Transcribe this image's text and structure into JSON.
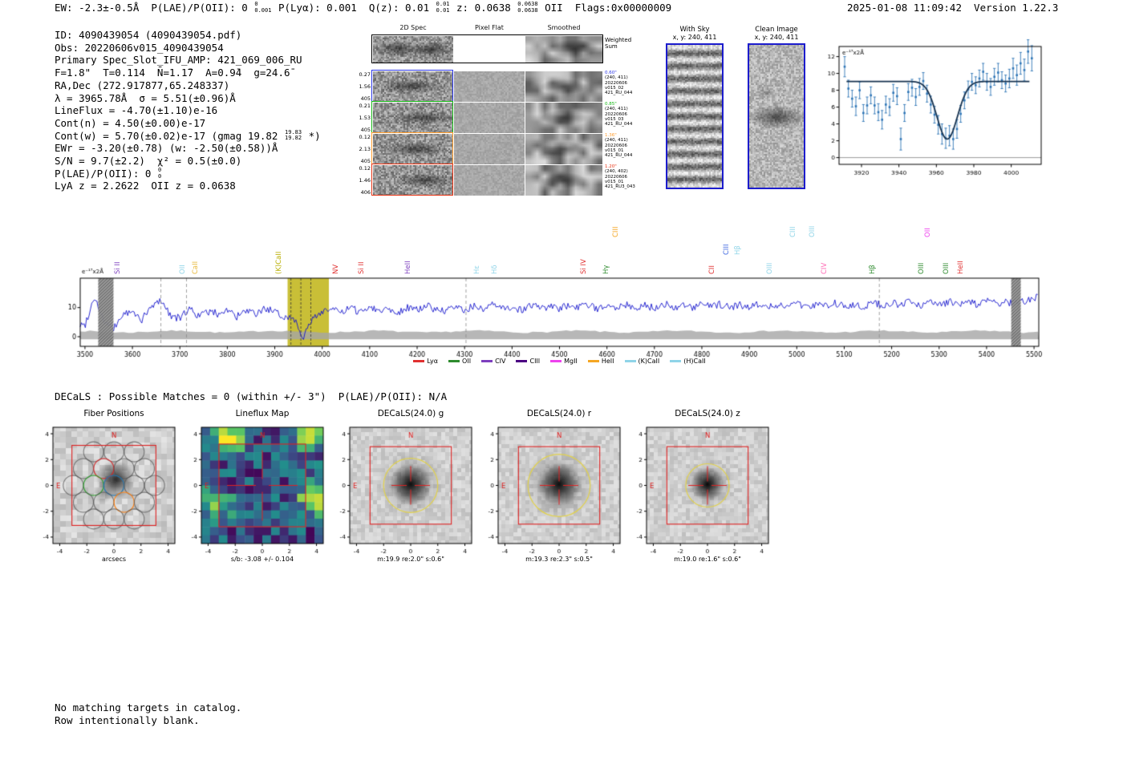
{
  "header": {
    "segments": [
      {
        "t": "EW: -2.3±-0.5Å  P(LAE)/P(OII): 0 "
      },
      {
        "sup": "0",
        "sub": "0.001"
      },
      {
        "t": " P(Lyα): 0.001  Q(z): 0.01 "
      },
      {
        "sup": "0.01",
        "sub": "0.01"
      },
      {
        "t": " z: 0.0638 "
      },
      {
        "sup": "0.0638",
        "sub": "0.0638"
      },
      {
        "t": " OII  Flags:0x00000009"
      }
    ],
    "right": "2025-01-08 11:09:42  Version 1.22.3"
  },
  "info_lines": [
    [
      {
        "t": "ID: 4090439054 (4090439054.pdf)"
      }
    ],
    [
      {
        "t": "Obs: 20220606v015_4090439054"
      }
    ],
    [
      {
        "t": "Primary Spec_Slot_IFU_AMP: 421_069_006_RU"
      }
    ],
    [
      {
        "t": "F=1.8\"  T=0.114  N̄=1.1̄7  A=0.9̄4  g=24.6̄"
      }
    ],
    [
      {
        "t": "RA,Dec (272.917877,65.248337)"
      }
    ],
    [
      {
        "t": "λ = 3965.78Å  σ = 5.51(±0.96)Å"
      }
    ],
    [
      {
        "t": "LineFlux = -4.70(±1.10)e-16"
      }
    ],
    [
      {
        "t": "Cont(n) = 4.50(±0.00)e-17"
      }
    ],
    [
      {
        "t": "Cont(w) = 5.70(±0.02)e-17 (gmag 19.82 "
      },
      {
        "sup": "19.83",
        "sub": "19.82"
      },
      {
        "t": " *)"
      }
    ],
    [
      {
        "t": "EWr = -3.20(±0.78) (w: -2.50(±0.58))Å"
      }
    ],
    [
      {
        "t": "S/N = 9.7(±2.2)  χ² = 0.5(±0.0)"
      }
    ],
    [
      {
        "t": "P(LAE)/P(OII): 0 "
      },
      {
        "sup": "0",
        "sub": "0"
      }
    ],
    [
      {
        "t": "LyA z = 2.2622  OII z = 0.0638"
      }
    ]
  ],
  "spec2d": {
    "col_headers": [
      "2D Spec",
      "Pixel Flat",
      "Smoothed"
    ],
    "weighted_label": "Weighted Sum",
    "rows": [
      {
        "left": [
          "0.27",
          "1.56",
          "405"
        ],
        "border": "#2a35e8",
        "ann": [
          "0.60\"",
          "(240, 411)",
          "20220606",
          "v015_02",
          "421_RU_044"
        ]
      },
      {
        "left": [
          "0.21",
          "1.53",
          "405"
        ],
        "border": "#16b816",
        "ann": [
          "0.85\"",
          "(240, 411)",
          "20220606",
          "v015_03",
          "421_RU_044"
        ]
      },
      {
        "left": [
          "0.12",
          "2.13",
          "405"
        ],
        "border": "#ff9d2e",
        "ann": [
          "1.36\"",
          "(240, 411)",
          "20220606",
          "v015_01",
          "421_RU_044"
        ]
      },
      {
        "left": [
          "0.12",
          "1.46",
          "406"
        ],
        "border": "#e83212",
        "ann": [
          "1.20\"",
          "(240, 402)",
          "20220606",
          "v015_01",
          "421_RU3_043"
        ]
      }
    ]
  },
  "aper": {
    "with_sky": {
      "title": "With Sky",
      "subtitle": "x, y: 240, 411"
    },
    "clean": {
      "title": "Clean Image",
      "subtitle": "x, y: 240, 411"
    }
  },
  "chart_data": [
    {
      "id": "line_fit",
      "type": "scatter",
      "ylabel": "e⁻¹⁷x2Å",
      "xlim": [
        3908,
        4016
      ],
      "ylim": [
        -0.8,
        13.2
      ],
      "xticks": [
        3920,
        3940,
        3960,
        3980,
        4000
      ],
      "yticks": [
        0,
        2,
        4,
        6,
        8,
        10,
        12
      ],
      "fit": {
        "continuum": 9.05,
        "center": 3965.78,
        "sigma": 5.51,
        "depth": 6.85,
        "x0": 3912,
        "x1": 4010
      },
      "points": [
        [
          3911,
          10.8,
          1.2
        ],
        [
          3913,
          8.2,
          1.0
        ],
        [
          3915,
          7.0,
          1.0
        ],
        [
          3917,
          6.1,
          1.1
        ],
        [
          3919,
          8.0,
          1.0
        ],
        [
          3921,
          5.3,
          1.0
        ],
        [
          3923,
          6.2,
          1.0
        ],
        [
          3925,
          7.4,
          1.0
        ],
        [
          3927,
          6.2,
          1.0
        ],
        [
          3929,
          5.4,
          1.0
        ],
        [
          3931,
          4.5,
          1.1
        ],
        [
          3933,
          6.3,
          1.0
        ],
        [
          3935,
          6.0,
          1.0
        ],
        [
          3937,
          7.7,
          1.0
        ],
        [
          3939,
          7.3,
          1.0
        ],
        [
          3941,
          2.2,
          1.3
        ],
        [
          3943,
          5.3,
          1.0
        ],
        [
          3945,
          7.8,
          1.0
        ],
        [
          3947,
          8.3,
          1.0
        ],
        [
          3949,
          7.2,
          1.0
        ],
        [
          3951,
          8.4,
          1.0
        ],
        [
          3953,
          9.1,
          1.0
        ],
        [
          3955,
          7.6,
          1.0
        ],
        [
          3957,
          6.3,
          1.0
        ],
        [
          3959,
          5.1,
          1.0
        ],
        [
          3961,
          3.9,
          1.1
        ],
        [
          3963,
          2.8,
          1.2
        ],
        [
          3965,
          2.3,
          1.2
        ],
        [
          3967,
          2.6,
          1.2
        ],
        [
          3969,
          2.2,
          1.2
        ],
        [
          3971,
          3.4,
          1.1
        ],
        [
          3973,
          5.2,
          1.0
        ],
        [
          3975,
          6.8,
          1.0
        ],
        [
          3977,
          8.1,
          1.0
        ],
        [
          3979,
          9.0,
          1.0
        ],
        [
          3981,
          8.6,
          1.0
        ],
        [
          3983,
          9.4,
          1.0
        ],
        [
          3985,
          10.2,
          1.0
        ],
        [
          3987,
          9.0,
          1.0
        ],
        [
          3989,
          8.4,
          1.0
        ],
        [
          3991,
          9.6,
          1.0
        ],
        [
          3993,
          10.1,
          1.1
        ],
        [
          3995,
          9.2,
          1.0
        ],
        [
          3997,
          8.8,
          1.0
        ],
        [
          3999,
          9.4,
          1.1
        ],
        [
          4001,
          10.6,
          1.2
        ],
        [
          4003,
          9.8,
          1.2
        ],
        [
          4005,
          11.2,
          1.3
        ],
        [
          4007,
          10.4,
          1.3
        ],
        [
          4009,
          12.6,
          1.4
        ],
        [
          4011,
          11.8,
          1.5
        ]
      ]
    },
    {
      "id": "main_spectrum",
      "type": "line",
      "ylabel": "e⁻¹⁷x2Å",
      "xlim": [
        3490,
        5510
      ],
      "ylim": [
        -3.3,
        20.1
      ],
      "xticks": [
        3500,
        3600,
        3700,
        3800,
        3900,
        4000,
        4100,
        4200,
        4300,
        4400,
        4500,
        4600,
        4700,
        4800,
        4900,
        5000,
        5100,
        5200,
        5300,
        5400,
        5500
      ],
      "yticks": [
        0,
        10
      ],
      "x_start": 3500,
      "x_step": 20,
      "values": [
        4.0,
        13.9,
        5.2,
        2.5,
        7.8,
        8.3,
        5.9,
        10.1,
        12.8,
        7.4,
        6.2,
        9.8,
        7.0,
        8.6,
        7.9,
        9.4,
        6.8,
        8.8,
        7.5,
        9.9,
        8.2,
        6.9,
        6.5,
        0.0,
        6.0,
        8.9,
        9.6,
        8.1,
        9.9,
        8.4,
        10.6,
        8.9,
        9.8,
        8.3,
        10.2,
        9.0,
        10.8,
        9.3,
        8.7,
        10.1,
        9.2,
        10.6,
        9.1,
        10.9,
        9.6,
        10.3,
        9.0,
        11.1,
        9.7,
        10.4,
        9.3,
        11.2,
        10.0,
        10.9,
        9.5,
        11.4,
        10.2,
        11.0,
        9.8,
        10.7,
        9.9,
        11.3,
        10.1,
        10.8,
        9.7,
        11.0,
        10.3,
        11.2,
        10.0,
        10.9,
        10.2,
        11.4,
        10.4,
        11.1,
        10.1,
        11.5,
        10.5,
        11.2,
        10.3,
        11.6,
        10.6,
        11.3,
        10.4,
        11.7,
        10.7,
        11.5,
        10.8,
        11.9,
        10.9,
        11.6,
        11.0,
        12.0,
        11.1,
        11.8,
        11.2,
        12.1,
        11.3,
        11.9,
        11.4,
        12.3,
        13.5
      ],
      "highlight": {
        "x0": 3927,
        "x1": 4014,
        "color": "#c9bf37"
      },
      "masked": [
        [
          3528,
          3560
        ],
        [
          5452,
          5472
        ]
      ],
      "dashed_lines": [
        3660,
        3714,
        4303,
        5174
      ],
      "dashed_dark": [
        3934,
        3955,
        3976
      ],
      "line_labels": [
        {
          "label": "Si II",
          "wave": 3597,
          "color": "#7d3fbe",
          "tier": 0
        },
        {
          "label": "OII",
          "wave": 3733,
          "color": "#8fd4e8",
          "tier": 0
        },
        {
          "label": "CaII",
          "wave": 3760,
          "color": "#e8b93c",
          "tier": 0
        },
        {
          "label": "(K)CaII",
          "wave": 3934,
          "color": "#b8ae00",
          "tier": 0
        },
        {
          "label": "NV",
          "wave": 4053,
          "color": "#e03030",
          "tier": 0
        },
        {
          "label": "Si II",
          "wave": 4106,
          "color": "#e03030",
          "tier": 0
        },
        {
          "label": "HeII",
          "wave": 4203,
          "color": "#7d3fbe",
          "tier": 0
        },
        {
          "label": "Hε",
          "wave": 4347,
          "color": "#8fd4e8",
          "tier": 0
        },
        {
          "label": "Hδ",
          "wave": 4384,
          "color": "#8fd4e8",
          "tier": 0
        },
        {
          "label": "Si IV",
          "wave": 4570,
          "color": "#e03030",
          "tier": 0
        },
        {
          "label": "Hγ",
          "wave": 4617,
          "color": "#2e8b2e",
          "tier": 0
        },
        {
          "label": "CIII",
          "wave": 4636,
          "color": "#f5a623",
          "tier": 2
        },
        {
          "label": "CII",
          "wave": 4838,
          "color": "#e03030",
          "tier": 0
        },
        {
          "label": "CIII",
          "wave": 4868,
          "color": "#4169e1",
          "tier": 1
        },
        {
          "label": "Hβ",
          "wave": 4890,
          "color": "#8fd4e8",
          "tier": 1
        },
        {
          "label": "OIII",
          "wave": 4958,
          "color": "#8fd4e8",
          "tier": 0
        },
        {
          "label": "CIII",
          "wave": 5007,
          "color": "#8fd4e8",
          "tier": 2
        },
        {
          "label": "OIII",
          "wave": 5047,
          "color": "#8fd4e8",
          "tier": 2
        },
        {
          "label": "CIV",
          "wave": 5072,
          "color": "#ff69b4",
          "tier": 0
        },
        {
          "label": "Hβ",
          "wave": 5172,
          "color": "#2e8b2e",
          "tier": 0
        },
        {
          "label": "OIII",
          "wave": 5274,
          "color": "#2e8b2e",
          "tier": 0
        },
        {
          "label": "OII",
          "wave": 5287,
          "color": "#ee42ee",
          "tier": 2
        },
        {
          "label": "OIII",
          "wave": 5326,
          "color": "#2e8b2e",
          "tier": 0
        },
        {
          "label": "HeII",
          "wave": 5356,
          "color": "#e03030",
          "tier": 0
        }
      ],
      "legend": [
        {
          "label": "Lyα",
          "color": "#e03030"
        },
        {
          "label": "OII",
          "color": "#2e8b2e"
        },
        {
          "label": "CIV",
          "color": "#7d3fbe"
        },
        {
          "label": "CIII",
          "color": "#4b0082"
        },
        {
          "label": "MgII",
          "color": "#ee42ee"
        },
        {
          "label": "HeII",
          "color": "#f5a623"
        },
        {
          "label": "(K)CaII",
          "color": "#8fd4e8"
        },
        {
          "label": "(H)CaII",
          "color": "#8fd4e8"
        }
      ]
    }
  ],
  "cutouts": {
    "header": "DECaLS : Possible Matches = 0 (within +/- 3\")  P(LAE)/P(OII): N/A",
    "ticks": [
      -4,
      -2,
      0,
      2,
      4
    ],
    "compass": {
      "n": "N",
      "e": "E"
    },
    "panels": [
      {
        "title": "Fiber Positions",
        "xlabel": "arcsecs",
        "type": "fiber"
      },
      {
        "title": "Lineflux Map",
        "xlabel": "s/b: -3.08 +/- 0.104",
        "type": "lineflux"
      },
      {
        "title": "DECaLS(24.0) g",
        "xlabel": "m:19.9 re:2.0\" s:0.6\"",
        "type": "image",
        "aperture_r": 2.0
      },
      {
        "title": "DECaLS(24.0) r",
        "xlabel": "m:19.3 re:2.3\" s:0.5\"",
        "type": "image",
        "aperture_r": 2.3
      },
      {
        "title": "DECaLS(24.0) z",
        "xlabel": "m:19.0 re:1.6\" s:0.6\"",
        "type": "image",
        "aperture_r": 1.6
      }
    ]
  },
  "footer_lines": [
    "No matching targets in catalog.",
    "Row intentionally blank."
  ]
}
